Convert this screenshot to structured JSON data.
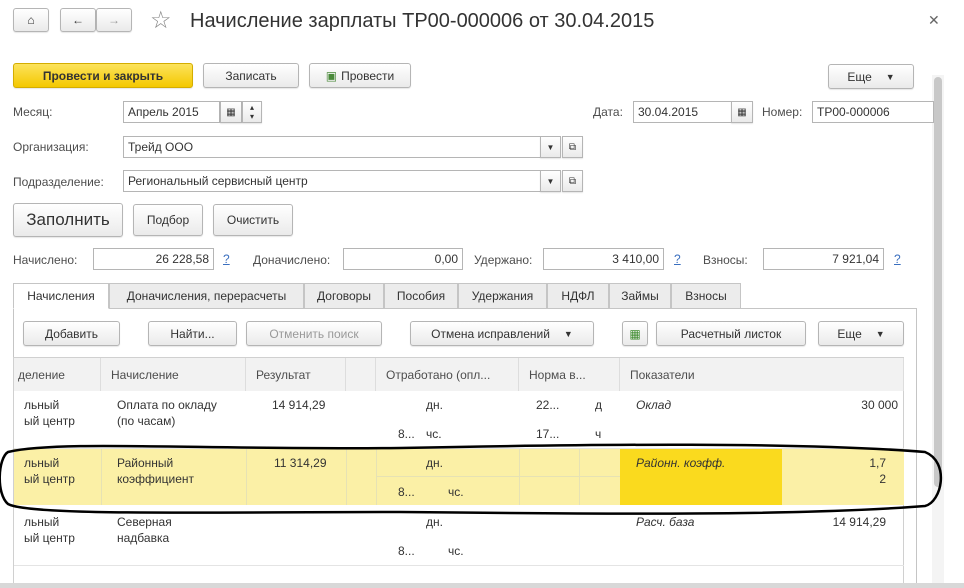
{
  "window": {
    "title": "Начисление зарплаты ТР00-000006 от 30.04.2015"
  },
  "toolbar": {
    "post_close": "Провести и закрыть",
    "save": "Записать",
    "post": "Провести",
    "more": "Еще"
  },
  "form": {
    "month_label": "Месяц:",
    "month_value": "Апрель 2015",
    "date_label": "Дата:",
    "date_value": "30.04.2015",
    "number_label": "Номер:",
    "number_value": "ТР00-000006",
    "org_label": "Организация:",
    "org_value": "Трейд ООО",
    "dept_label": "Подразделение:",
    "dept_value": "Региональный сервисный центр"
  },
  "actions": {
    "fill": "Заполнить",
    "select": "Подбор",
    "clear": "Очистить"
  },
  "totals": {
    "accrued_label": "Начислено:",
    "accrued": "26 228,58",
    "extra_label": "Доначислено:",
    "extra": "0,00",
    "withheld_label": "Удержано:",
    "withheld": "3 410,00",
    "contrib_label": "Взносы:",
    "contrib": "7 921,04",
    "help": "?"
  },
  "tabs": [
    "Начисления",
    "Доначисления, перерасчеты",
    "Договоры",
    "Пособия",
    "Удержания",
    "НДФЛ",
    "Займы",
    "Взносы"
  ],
  "table_toolbar": {
    "add": "Добавить",
    "find": "Найти...",
    "cancel_search": "Отменить поиск",
    "cancel_fix": "Отмена исправлений",
    "payslip": "Расчетный листок",
    "more": "Еще"
  },
  "columns": [
    "деление",
    "Начисление",
    "Результат",
    "",
    "Отработано (опл...",
    "Норма в...",
    "Показатели"
  ],
  "rows": [
    {
      "dept1": "льный",
      "dept2": "ый центр",
      "accrual1": "Оплата по окладу",
      "accrual2": "(по часам)",
      "result": "14 914,29",
      "days_unit": "дн.",
      "hours": "8...",
      "hours_unit": "чс.",
      "norm_days": "22...",
      "norm_days_unit": "д",
      "norm_hours": "17...",
      "norm_hours_unit": "ч",
      "indicator": "Оклад",
      "ind_value": "30 000"
    },
    {
      "dept1": "льный",
      "dept2": "ый центр",
      "accrual1": "Районный",
      "accrual2": "коэффициент",
      "result": "11 314,29",
      "days_unit": "дн.",
      "hours": "8...",
      "hours_unit": "чс.",
      "indicator": "Районн. коэфф.",
      "ind_value": "1,7",
      "ind_value2": "2"
    },
    {
      "dept1": "льный",
      "dept2": "ый центр",
      "accrual1": "Северная",
      "accrual2": "надбавка",
      "result": "",
      "days_unit": "дн.",
      "hours": "8...",
      "hours_unit": "чс.",
      "indicator": "Расч. база",
      "ind_value": "14 914,29"
    }
  ]
}
